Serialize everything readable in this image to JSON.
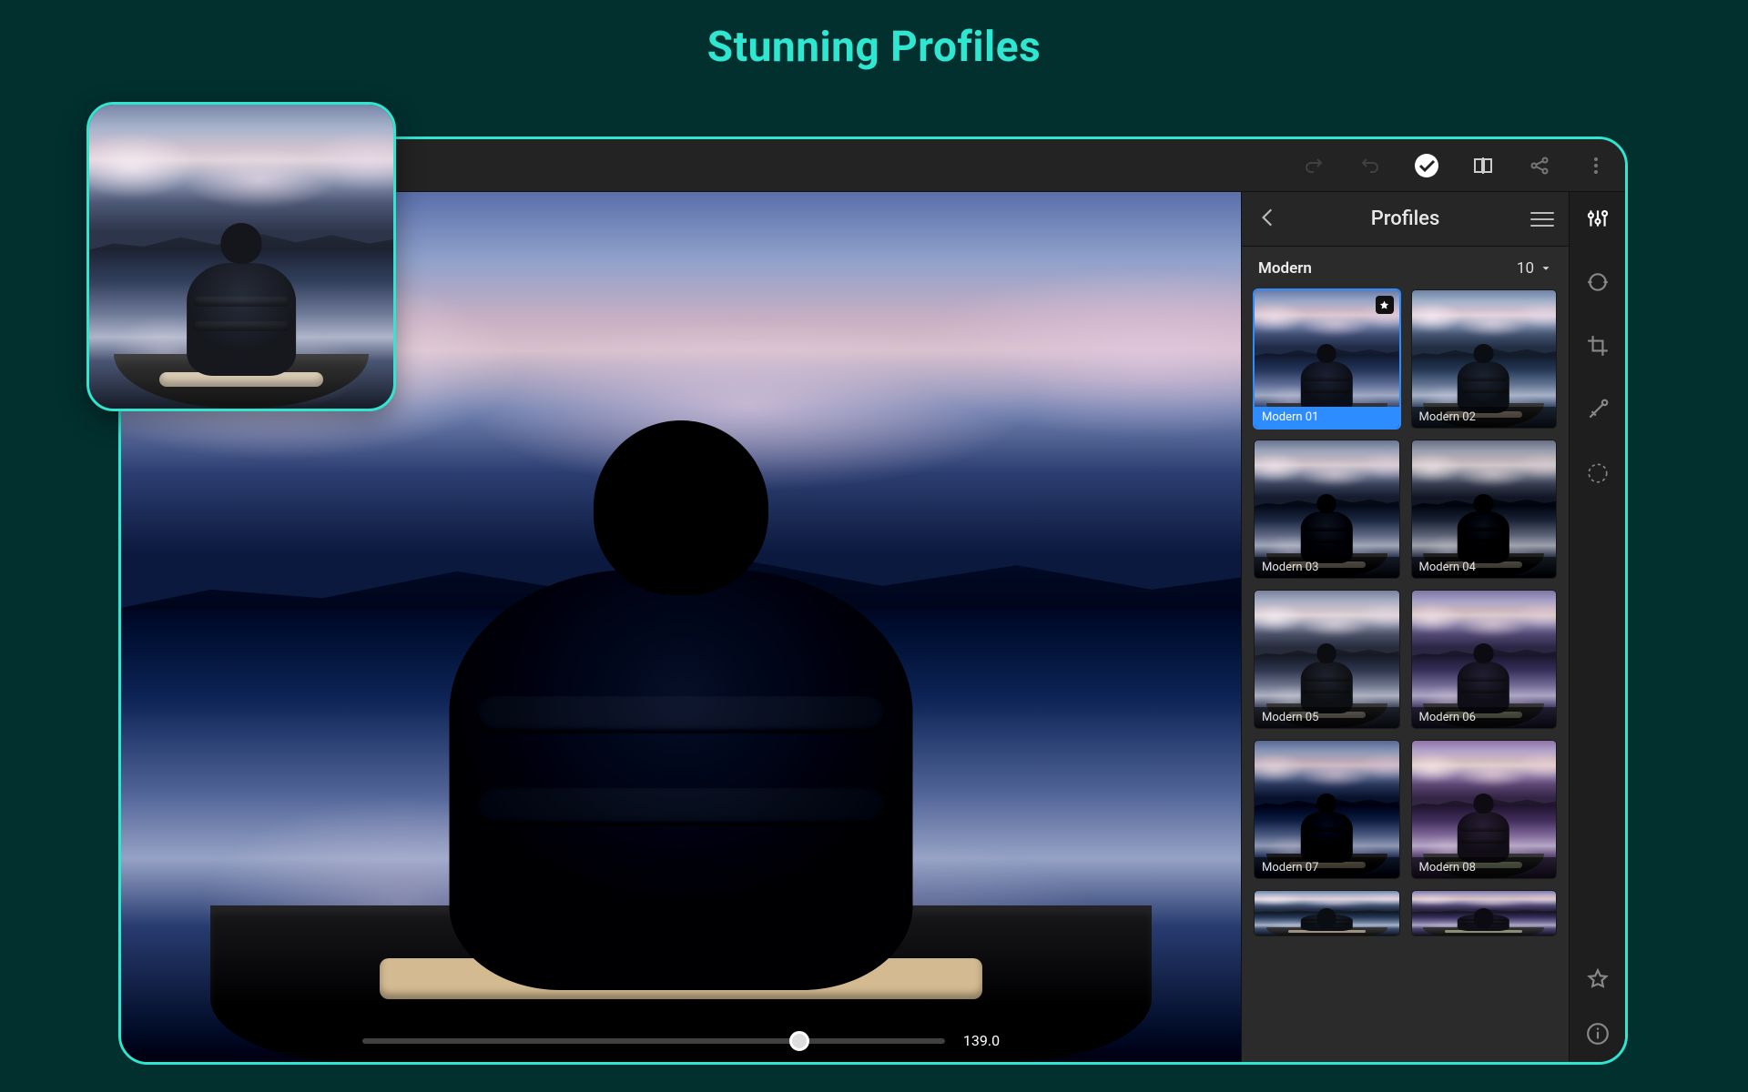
{
  "promo": {
    "headline": "Stunning Profiles"
  },
  "topbar": {
    "redo": "redo",
    "undo": "undo",
    "apply": "apply",
    "compare": "before-after",
    "share": "share",
    "more": "more"
  },
  "panel": {
    "title": "Profiles",
    "group_name": "Modern",
    "group_count": "10"
  },
  "slider": {
    "value": "139.0"
  },
  "profiles": [
    {
      "label": "Modern 01",
      "tint": "tint-none",
      "selected": true,
      "starred": true
    },
    {
      "label": "Modern 02",
      "tint": "tint-02",
      "selected": false,
      "starred": false
    },
    {
      "label": "Modern 03",
      "tint": "tint-03",
      "selected": false,
      "starred": false
    },
    {
      "label": "Modern 04",
      "tint": "tint-04",
      "selected": false,
      "starred": false
    },
    {
      "label": "Modern 05",
      "tint": "tint-05",
      "selected": false,
      "starred": false
    },
    {
      "label": "Modern 06",
      "tint": "tint-06",
      "selected": false,
      "starred": false
    },
    {
      "label": "Modern 07",
      "tint": "tint-07",
      "selected": false,
      "starred": false
    },
    {
      "label": "Modern 08",
      "tint": "tint-08",
      "selected": false,
      "starred": false
    }
  ]
}
